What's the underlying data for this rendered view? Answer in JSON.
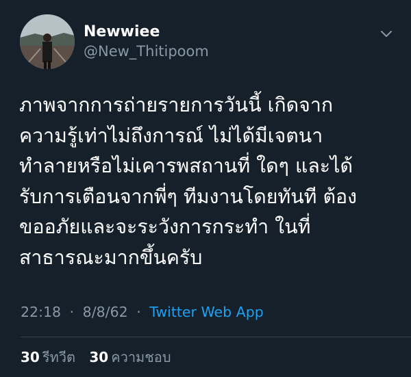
{
  "tweet": {
    "display_name": "Newwiee",
    "handle": "@New_Thitipoom",
    "body_lines": [
      "ภาพจากการถ่ายรายการวันนี้ เกิดจาก",
      "ความรู้เท่าไม่ถึงการณ์ ไม่ได้มีเจตนา",
      "ทำลายหรือไม่เคารพสถานที่ ใดๆ และได้",
      "รับการเตือนจากพี่ๆ ทีมงานโดยทันที ต้อง",
      "ขออภัยและจะระวังการกระทำ ในที่",
      "สาธารณะมากขึ้นครับ"
    ],
    "time": "22:18",
    "date": "8/8/62",
    "separator": "·",
    "source": "Twitter Web App",
    "retweets_count": "30",
    "retweets_label": "รีทวีต",
    "likes_count": "30",
    "likes_label": "ความชอบ"
  },
  "icons": {
    "menu_caret": "chevron-down-icon"
  },
  "colors": {
    "background": "#15202b",
    "primary_text": "#ffffff",
    "secondary_text": "#8899a6",
    "link": "#1da1f2",
    "divider": "#38444d"
  }
}
